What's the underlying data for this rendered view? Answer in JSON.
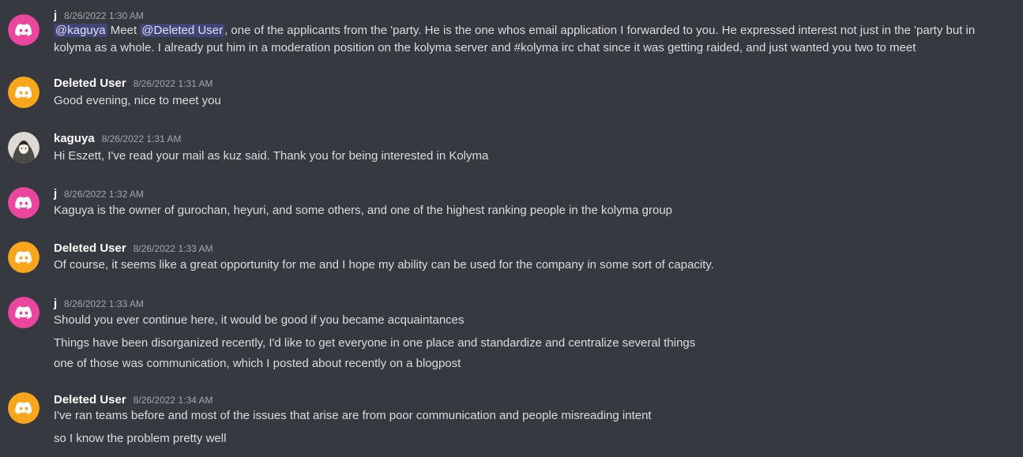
{
  "colors": {
    "background": "#36393f",
    "pink_avatar": "#eb459e",
    "orange_avatar": "#faa61a",
    "mention_bg": "#3c4270",
    "mention_text": "#dee0fc"
  },
  "messages": [
    {
      "author": "j",
      "timestamp": "8/26/2022 1:30 AM",
      "avatar": "discord-logo-icon-pink",
      "lines": [
        {
          "mention1": "@kaguya",
          "t1": " Meet ",
          "mention2": "@Deleted User",
          "t2": ", one of the applicants from the 'party. He is the one whos email application I forwarded to you. He expressed interest not just in the 'party but in kolyma as a whole. I already put him in a moderation position on the kolyma server and #kolyma irc chat since it was getting raided, and just wanted you two to meet"
        }
      ]
    },
    {
      "author": "Deleted User",
      "timestamp": "8/26/2022 1:31 AM",
      "avatar": "discord-logo-icon-orange",
      "lines": [
        "Good evening, nice to meet you"
      ]
    },
    {
      "author": "kaguya",
      "timestamp": "8/26/2022 1:31 AM",
      "avatar": "profile-picture",
      "lines": [
        "Hi Eszett, I've read your mail as kuz said. Thank you for being interested in Kolyma"
      ]
    },
    {
      "author": "j",
      "timestamp": "8/26/2022 1:32 AM",
      "avatar": "discord-logo-icon-pink",
      "lines": [
        "Kaguya is the owner of gurochan, heyuri, and some others, and one of the highest ranking people in the kolyma group"
      ]
    },
    {
      "author": "Deleted User",
      "timestamp": "8/26/2022 1:33 AM",
      "avatar": "discord-logo-icon-orange",
      "lines": [
        "Of course, it seems like a great opportunity for me and I hope my ability can be used for the company in some sort of capacity."
      ]
    },
    {
      "author": "j",
      "timestamp": "8/26/2022 1:33 AM",
      "avatar": "discord-logo-icon-pink",
      "lines": [
        "Should you ever continue here, it would be good if you became acquaintances",
        "Things have been disorganized recently, I'd like to get everyone in one place and standardize and centralize several things",
        "one of those was communication, which I posted about recently on a blogpost"
      ]
    },
    {
      "author": "Deleted User",
      "timestamp": "8/26/2022 1:34 AM",
      "avatar": "discord-logo-icon-orange",
      "lines": [
        "I've ran teams before and most of the issues that arise are from poor communication and people misreading intent",
        "so I know the problem pretty well"
      ]
    }
  ]
}
